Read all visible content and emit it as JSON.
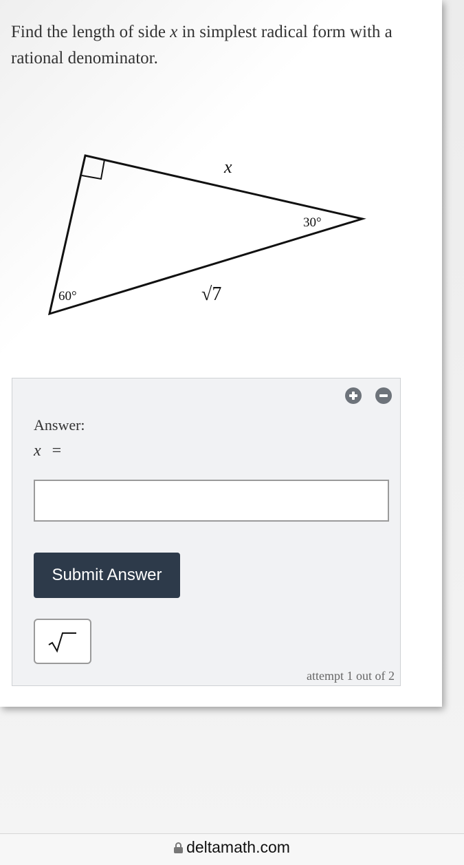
{
  "question": {
    "text_before": "Find the length of side ",
    "variable": "x",
    "text_after": " in simplest radical form with a rational denominator."
  },
  "diagram": {
    "side_label_top": "x",
    "angle_right_vertex": "30°",
    "angle_bottom_left": "60°",
    "hypotenuse_label": "√7"
  },
  "answer": {
    "label": "Answer:",
    "variable": "x",
    "equals": "=",
    "input_value": "",
    "submit_label": "Submit Answer",
    "sqrt_button_symbol": "√",
    "attempt_text": "attempt 1 out of 2"
  },
  "browser": {
    "url": "deltamath.com"
  },
  "colors": {
    "submit_bg": "#2d3a4a",
    "icon_bg": "#6d737a",
    "panel_bg": "#f1f2f4"
  },
  "icons": [
    "plus-circle-icon",
    "minus-circle-icon",
    "square-root-icon",
    "lock-icon",
    "right-angle-icon"
  ]
}
